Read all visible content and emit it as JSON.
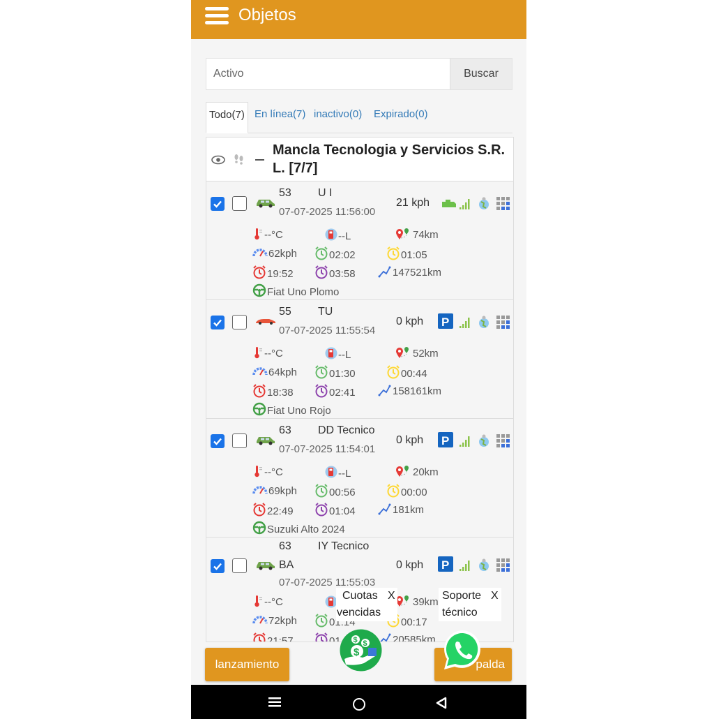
{
  "app": {
    "title": "Objetos"
  },
  "search": {
    "placeholder": "Activo",
    "button_label": "Buscar"
  },
  "tabs": [
    {
      "label": "Todo(7)"
    },
    {
      "label": "En línea(7)"
    },
    {
      "label": "inactivo(0)"
    },
    {
      "label": "Expirado(0)"
    }
  ],
  "group": {
    "title": "Mancla Tecnologia y Servicios S.R. L. [7/7]"
  },
  "vehicles": [
    {
      "id": "53",
      "name": "U I",
      "time": "07-07-2025 11:56:00",
      "speed": "21 kph",
      "status": "engine",
      "car_color": "#6fa34a",
      "temp": "--°C",
      "fuel": "--L",
      "distance": "74km",
      "max_speed": "62kph",
      "time_green": "02:02",
      "time_yellow": "01:05",
      "time_red": "19:52",
      "time_purple": "03:58",
      "odometer": "147521km",
      "driver": "Fiat Uno Plomo"
    },
    {
      "id": "55",
      "name": "TU",
      "time": "07-07-2025 11:55:54",
      "speed": "0 kph",
      "status": "parked",
      "car_color": "#e8553a",
      "temp": "--°C",
      "fuel": "--L",
      "distance": "52km",
      "max_speed": "64kph",
      "time_green": "01:30",
      "time_yellow": "00:44",
      "time_red": "18:38",
      "time_purple": "02:41",
      "odometer": "158161km",
      "driver": "Fiat Uno Rojo"
    },
    {
      "id": "63",
      "name": "DD Tecnico",
      "time": "07-07-2025 11:54:01",
      "speed": "0 kph",
      "status": "parked",
      "car_color": "#6fa34a",
      "temp": "--°C",
      "fuel": "--L",
      "distance": "20km",
      "max_speed": "69kph",
      "time_green": "00:56",
      "time_yellow": "00:00",
      "time_red": "22:49",
      "time_purple": "01:04",
      "odometer": "181km",
      "driver": "Suzuki Alto 2024"
    },
    {
      "id": "63",
      "name": "IY Tecnico",
      "name2": "BA",
      "time": "07-07-2025 11:55:03",
      "speed": "0 kph",
      "status": "parked",
      "car_color": "#6fa34a",
      "temp": "--°C",
      "distance": "39km",
      "max_speed": "72kph",
      "time_green_partial": "01:14",
      "time_yellow": "00:17",
      "time_red": "21:57",
      "time_purple_partial": "01",
      "odometer": "20585km"
    }
  ],
  "buttons": {
    "launch": "lanzamiento",
    "backup": "palda"
  },
  "popups": {
    "cuotas": {
      "label_line1": "Cuotas",
      "label_line2": "vencidas",
      "close": "X"
    },
    "soporte": {
      "label_line1": "Soporte",
      "label_line2": "técnico",
      "close": "X"
    }
  },
  "icons": {
    "menu": "menu-icon",
    "eye": "eye-icon",
    "footprint": "footprint-icon",
    "engine": "engine-icon",
    "parking": "parking-icon",
    "signal": "signal-icon",
    "globe": "globe-icon",
    "grid": "grid-icon",
    "money": "money-icon",
    "whatsapp": "whatsapp-icon"
  },
  "colors": {
    "accent": "#e0961f",
    "checkbox": "#1a73e8",
    "parking": "#1565c0",
    "signal": "#8bc34a",
    "whatsapp": "#25d366"
  }
}
